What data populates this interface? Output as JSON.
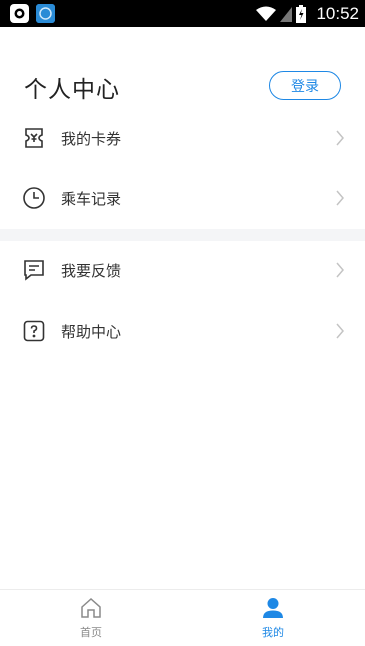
{
  "status_bar": {
    "time": "10:52"
  },
  "header": {
    "title": "个人中心",
    "login_label": "登录"
  },
  "menu": {
    "items": [
      {
        "label": "我的卡券",
        "icon": "ticket-icon"
      },
      {
        "label": "乘车记录",
        "icon": "clock-icon"
      },
      {
        "label": "我要反馈",
        "icon": "feedback-icon"
      },
      {
        "label": "帮助中心",
        "icon": "help-icon"
      }
    ]
  },
  "tabbar": {
    "tabs": [
      {
        "label": "首页",
        "icon": "home-icon",
        "active": false
      },
      {
        "label": "我的",
        "icon": "user-icon",
        "active": true
      }
    ]
  },
  "colors": {
    "accent": "#1e88e5",
    "inactive_tab": "#8a8a8a",
    "divider_band": "#f4f5f7"
  }
}
